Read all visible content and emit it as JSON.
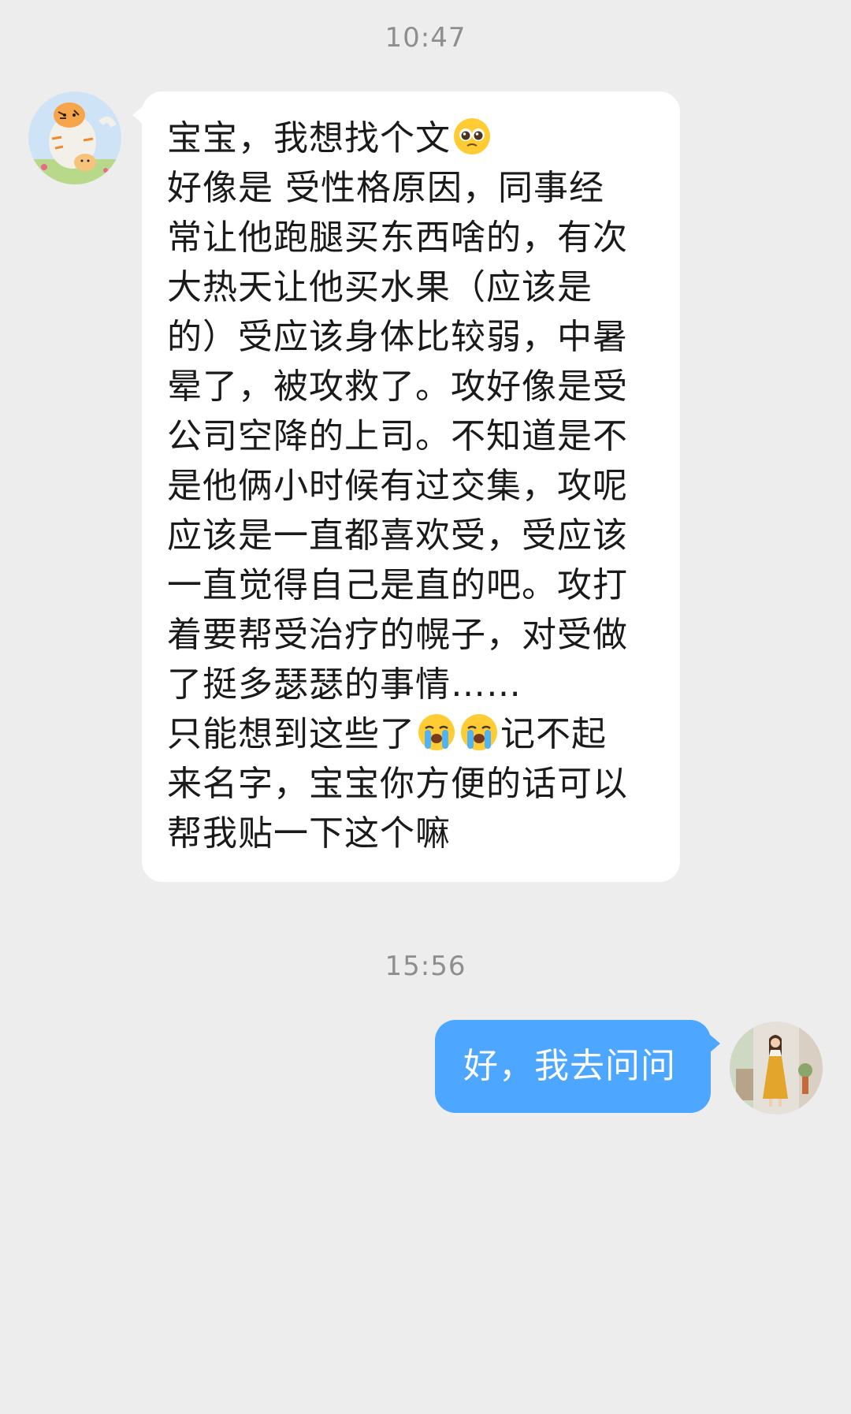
{
  "chat": {
    "timestamps": [
      "10:47",
      "15:56"
    ],
    "messages": [
      {
        "sender": "other",
        "avatar_icon": "tiger-cartoon-avatar-icon",
        "line1_before_emoji": "宝宝，我想找个文",
        "line1_emoji": "pleading-face-emoji-icon",
        "line2": "好像是  受性格原因，同事经",
        "line3": "常让他跑腿买东西啥的，有次",
        "line4": "大热天让他买水果（应该是",
        "line5": "的）受应该身体比较弱，中暑",
        "line6": "晕了，被攻救了。攻好像是受",
        "line7": "公司空降的上司。不知道是不",
        "line8": "是他俩小时候有过交集，攻呢",
        "line9": "应该是一直都喜欢受，受应该",
        "line10": "一直觉得自己是直的吧。攻打",
        "line11": "着要帮受治疗的幌子，对受做",
        "line12": "了挺多瑟瑟的事情……",
        "line13_before_emoji": "只能想到这些了",
        "line13_emojis": [
          "loudly-crying-face-emoji-icon",
          "loudly-crying-face-emoji-icon"
        ],
        "line13_after_emoji": "记不起",
        "line14": "来名字，宝宝你方便的话可以",
        "line15": "帮我贴一下这个嘛"
      },
      {
        "sender": "self",
        "avatar_icon": "girl-yellow-dress-photo-avatar-icon",
        "text": "好，我去问问"
      }
    ]
  },
  "colors": {
    "background": "#ededed",
    "incoming_bubble": "#ffffff",
    "outgoing_bubble": "#4da6ff",
    "timestamp_text": "#8e8e8e"
  }
}
